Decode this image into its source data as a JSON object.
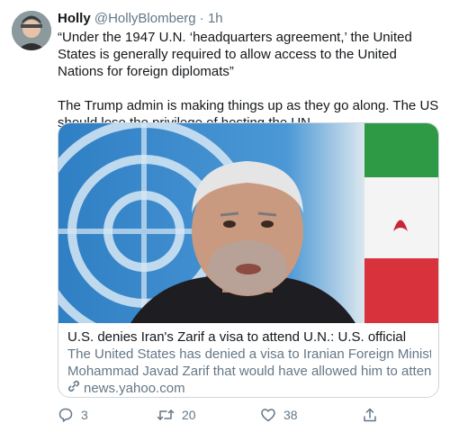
{
  "author": {
    "name": "Holly",
    "handle": "@HollyBlomberg",
    "separator": "·",
    "time": "1h"
  },
  "tweet": {
    "paragraph1": "“Under the 1947 U.N. ‘headquarters agreement,’ the United States is generally required to allow access to the United Nations for foreign diplomats”",
    "paragraph2": "The Trump admin is making things up as they go along. The US should lose the privilege of hosting the UN"
  },
  "card": {
    "title": "U.S. denies Iran's Zarif a visa to attend U.N.: U.S. official",
    "description_line1": "The United States has denied a visa to Iranian Foreign Minister",
    "description_line2": "Mohammad Javad Zarif that would have allowed him to attend a …",
    "domain": "news.yahoo.com"
  },
  "actions": {
    "replies": "3",
    "retweets": "20",
    "likes": "38"
  },
  "colors": {
    "text": "#14171a",
    "muted": "#657786",
    "border": "#ccd6dd"
  },
  "icons": [
    "reply-icon",
    "retweet-icon",
    "like-icon",
    "share-icon",
    "link-icon"
  ]
}
